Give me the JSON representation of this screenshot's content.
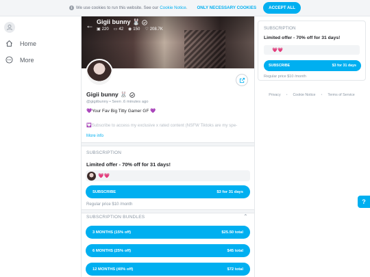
{
  "cookie": {
    "text": "We use cookies to run this website. See our",
    "link": "Cookie Notice",
    "necessary_label": "ONLY NECESSARY COOKIES",
    "accept_label": "ACCEPT ALL"
  },
  "nav": {
    "items": [
      {
        "label": "Home",
        "icon": "home-icon"
      },
      {
        "label": "More",
        "icon": "more-icon"
      }
    ]
  },
  "profile": {
    "name": "Gigii bunny 🐰",
    "handle": "@gigiibunny",
    "seen": "Seen .6 minutes ago",
    "stats": {
      "photos": "220",
      "videos": "42",
      "streams": "150",
      "likes": "208.7K"
    },
    "bio": "💜Your Fav Big Titty Gamer GF 💜",
    "bio_more": "💟Subscribe to access my exclusive x rated content (NSFW Tiktoks are my spe-",
    "more_info": "More info"
  },
  "subscription": {
    "section_title": "SUBSCRIPTION",
    "offer": "Limited offer - 70% off for 31 days!",
    "hearts": "💗💗",
    "subscribe_label": "SUBSCRIBE",
    "subscribe_price": "$3 for 31 days",
    "regular": "Regular price $10 /month"
  },
  "bundles": {
    "section_title": "SUBSCRIPTION BUNDLES",
    "items": [
      {
        "label": "3 MONTHS (15% off)",
        "price": "$25.50 total"
      },
      {
        "label": "6 MONTHS (25% off)",
        "price": "$45 total"
      },
      {
        "label": "12 MONTHS (40% off)",
        "price": "$72 total"
      }
    ]
  },
  "right": {
    "section_title": "SUBSCRIPTION",
    "offer": "Limited offer - 70% off for 31 days!",
    "hearts": "💗💗",
    "subscribe_label": "SUBSCRIBE",
    "subscribe_price": "$3 for 31 days",
    "regular": "Regular price $10 /month",
    "footer": [
      "Privacy",
      "Cookie Notice",
      "Terms of Service"
    ]
  },
  "help_label": "?",
  "colors": {
    "accent": "#00aff0",
    "text": "#242529",
    "muted": "#8a96a3",
    "heart": "#ff4f7b"
  }
}
